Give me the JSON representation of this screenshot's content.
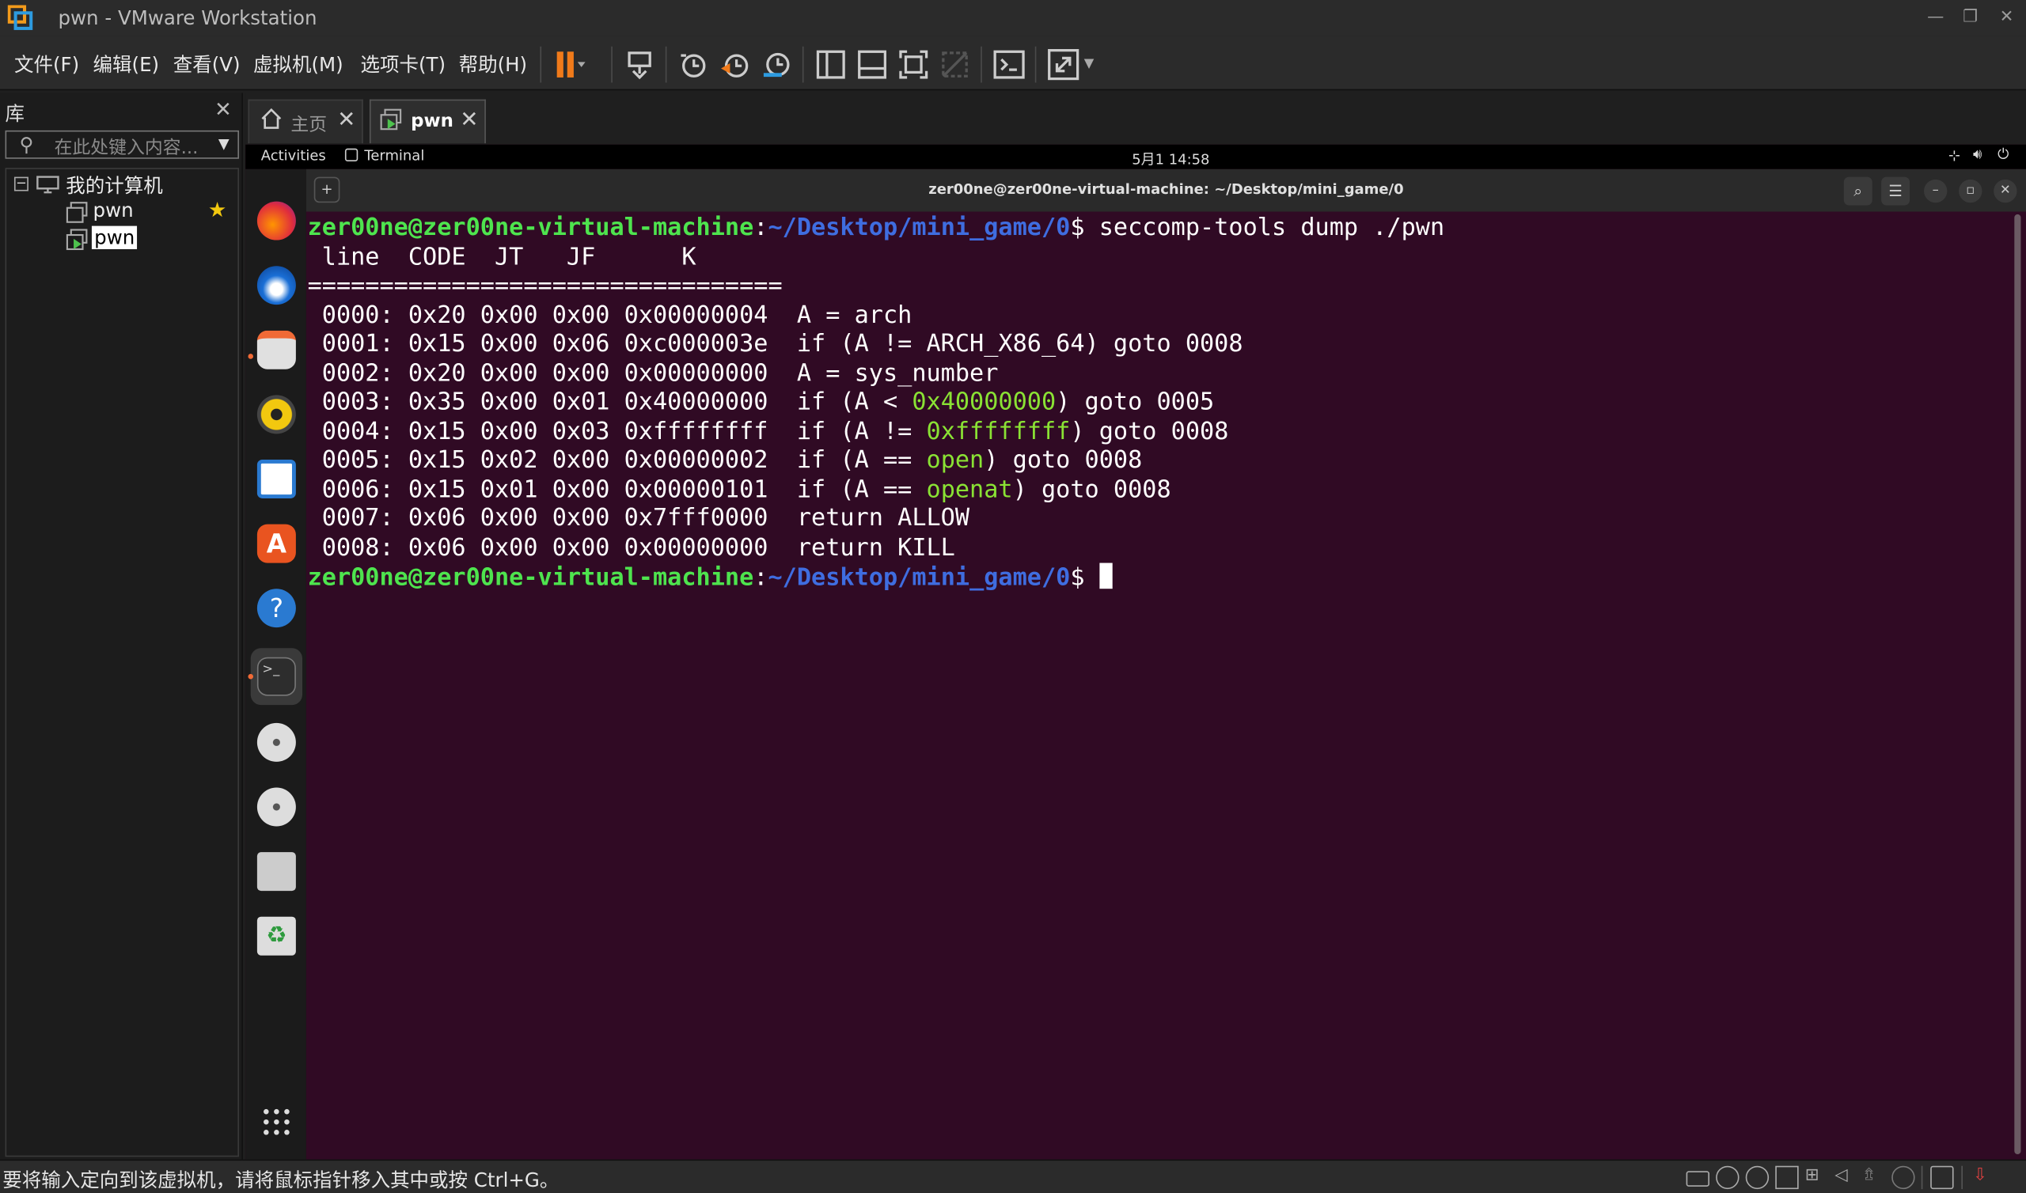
{
  "window": {
    "title": "pwn - VMware Workstation"
  },
  "menus": [
    "文件(F)",
    "编辑(E)",
    "查看(V)",
    "虚拟机(M)",
    "选项卡(T)",
    "帮助(H)"
  ],
  "library": {
    "title": "库",
    "search_placeholder": "在此处键入内容...",
    "root_label": "我的计算机",
    "items": [
      "pwn",
      "pwn"
    ]
  },
  "tabs": [
    {
      "label": "主页"
    },
    {
      "label": "pwn"
    }
  ],
  "guest": {
    "activities": "Activities",
    "active_app": "Terminal",
    "clock": "5月1 14:58",
    "terminal_title": "zer00ne@zer00ne-virtual-machine: ~/Desktop/mini_game/0"
  },
  "terminal": {
    "prompt_user": "zer00ne@zer00ne-virtual-machine",
    "prompt_sep": ":",
    "prompt_path": "~/Desktop/mini_game/0",
    "prompt_end": "$",
    "command": " seccomp-tools dump ./pwn",
    "header": " line  CODE  JT   JF      K",
    "divider": "=================================",
    "rows": [
      {
        "pre": " 0000: 0x20 0x00 0x00 0x00000004  A = arch",
        "hl": "",
        "post": ""
      },
      {
        "pre": " 0001: 0x15 0x00 0x06 0xc000003e  if (A != ARCH_X86_64) goto 0008",
        "hl": "",
        "post": ""
      },
      {
        "pre": " 0002: 0x20 0x00 0x00 0x00000000  A = sys_number",
        "hl": "",
        "post": ""
      },
      {
        "pre": " 0003: 0x35 0x00 0x01 0x40000000  if (A < ",
        "hl": "0x40000000",
        "post": ") goto 0005"
      },
      {
        "pre": " 0004: 0x15 0x00 0x03 0xffffffff  if (A != ",
        "hl": "0xffffffff",
        "post": ") goto 0008"
      },
      {
        "pre": " 0005: 0x15 0x02 0x00 0x00000002  if (A == ",
        "hl": "open",
        "post": ") goto 0008"
      },
      {
        "pre": " 0006: 0x15 0x01 0x00 0x00000101  if (A == ",
        "hl": "openat",
        "post": ") goto 0008"
      },
      {
        "pre": " 0007: 0x06 0x00 0x00 0x7fff0000  return ALLOW",
        "hl": "",
        "post": ""
      },
      {
        "pre": " 0008: 0x06 0x00 0x00 0x00000000  return KILL",
        "hl": "",
        "post": ""
      }
    ]
  },
  "status": {
    "text": "要将输入定向到该虚拟机，请将鼠标指针移入其中或按 Ctrl+G。"
  },
  "colors": {
    "terminal_bg": "#300a24",
    "prompt_user": "#4ee44e",
    "prompt_path": "#3f6de0",
    "highlight": "#8ae234",
    "pause_icon": "#f07a1a"
  }
}
